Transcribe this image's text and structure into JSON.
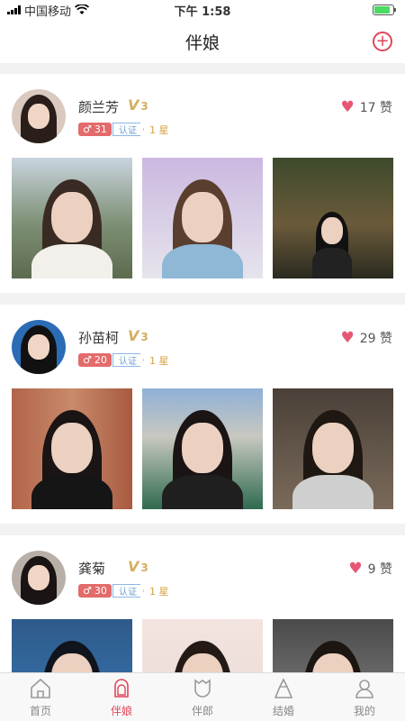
{
  "status": {
    "carrier": "中国移动",
    "time": "下午 1:58",
    "battery_level": 0.85
  },
  "nav": {
    "title": "伴娘",
    "add_icon": "plus-circle-icon"
  },
  "accent_color": "#e0465a",
  "cards": [
    {
      "name": "颜兰芳",
      "vip_level": "3",
      "level": "31",
      "cert": "认证",
      "stars": "1 星",
      "likes": "17",
      "likes_unit": "赞"
    },
    {
      "name": "孙苗柯",
      "vip_level": "3",
      "level": "20",
      "cert": "认证",
      "stars": "1 星",
      "likes": "29",
      "likes_unit": "赞"
    },
    {
      "name": "龚菊",
      "vip_level": "3",
      "level": "30",
      "cert": "认证",
      "stars": "1 星",
      "likes": "9",
      "likes_unit": "赞"
    }
  ],
  "tabs": [
    {
      "label": "首页",
      "icon": "home-icon"
    },
    {
      "label": "伴娘",
      "icon": "bridesmaid-icon",
      "active": true
    },
    {
      "label": "伴郎",
      "icon": "groomsman-icon"
    },
    {
      "label": "结婚",
      "icon": "wedding-icon"
    },
    {
      "label": "我的",
      "icon": "user-icon"
    }
  ]
}
